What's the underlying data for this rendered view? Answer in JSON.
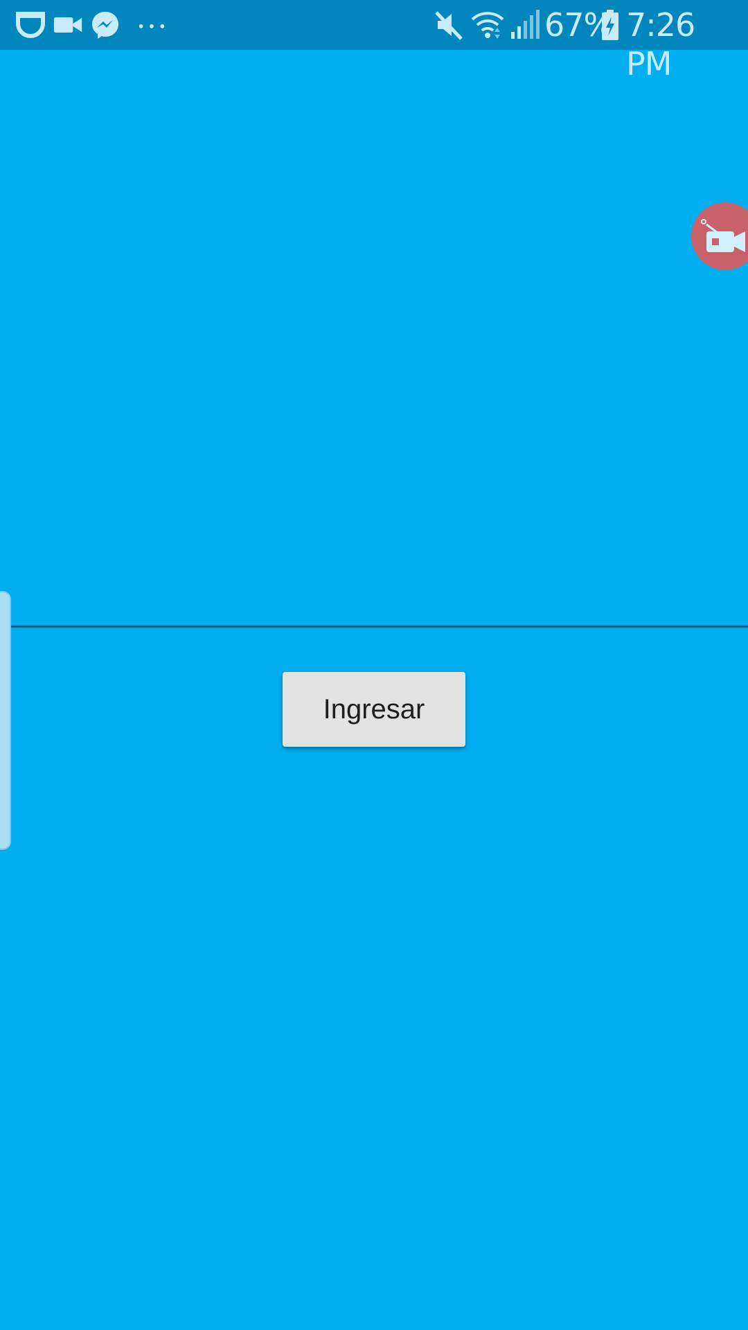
{
  "status_bar": {
    "notification_icons": [
      "dash-cam-icon",
      "video-camera-icon",
      "messenger-icon",
      "more-dots-icon"
    ],
    "system_icons": [
      "mute-icon",
      "wifi-icon",
      "signal-icon",
      "battery-charging-icon"
    ],
    "battery_percent": "67%",
    "time": "7:26 PM",
    "colors": {
      "background": "#0086BD",
      "icon": "#BFE6F7"
    }
  },
  "main": {
    "background_color": "#00AEEF",
    "login_button_label": "Ingresar"
  },
  "overlays": {
    "floating_recorder_icon": "camera-recorder-icon",
    "floating_color": "#C7626B",
    "side_handle_color": "#A9DDF2"
  }
}
